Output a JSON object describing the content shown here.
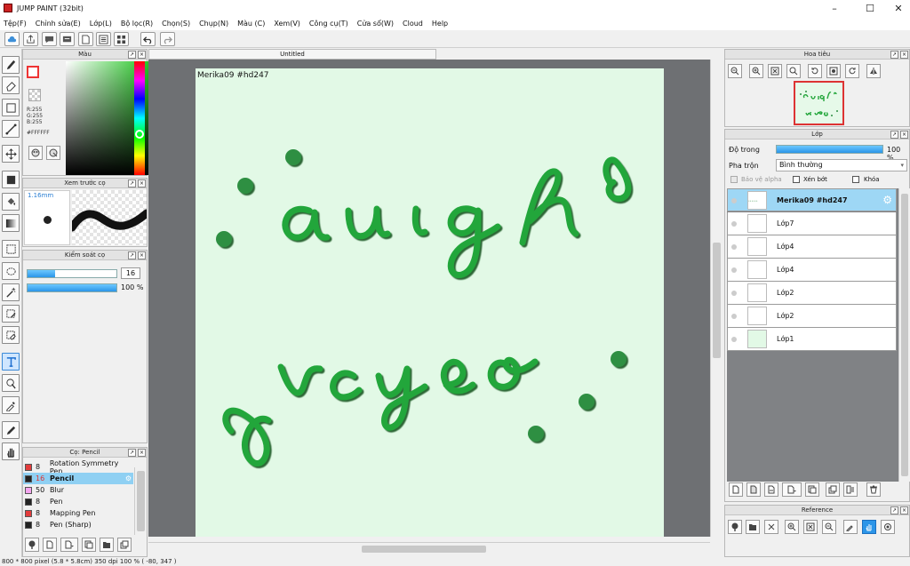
{
  "window": {
    "title": "JUMP PAINT (32bit)"
  },
  "menu": [
    "Tệp(F)",
    "Chỉnh sửa(E)",
    "Lớp(L)",
    "Bộ lọc(R)",
    "Chọn(S)",
    "Chụp(N)",
    "Màu (C)",
    "Xem(V)",
    "Công cụ(T)",
    "Cửa sổ(W)",
    "Cloud",
    "Help"
  ],
  "document": {
    "tab": "Untitled",
    "canvas_text": "Merika09  #hd247"
  },
  "color_panel": {
    "title": "Màu",
    "r": "R:255",
    "g": "G:255",
    "b": "B:255",
    "hex": "#FFFFFF"
  },
  "brush_preview": {
    "title": "Xem trước cọ",
    "size": "1.16mm"
  },
  "brush_control": {
    "title": "Kiểm soát cọ",
    "size": "16",
    "opacity": "100 %",
    "size_fraction": 0.31,
    "opacity_fraction": 1.0
  },
  "brush_panel": {
    "title": "Cọ: Pencil",
    "items": [
      {
        "size": "8",
        "name": "Rotation Symmetry Pen",
        "color": "#e23b3b"
      },
      {
        "size": "16",
        "name": "Pencil",
        "color": "#222222",
        "selected": true
      },
      {
        "size": "50",
        "name": "Blur",
        "color": "#f5a6f0"
      },
      {
        "size": "8",
        "name": "Pen",
        "color": "#222222"
      },
      {
        "size": "8",
        "name": "Mapping Pen",
        "color": "#e23b3b"
      },
      {
        "size": "8",
        "name": "Pen (Sharp)",
        "color": "#222222"
      }
    ]
  },
  "navigator": {
    "title": "Hoa tiêu"
  },
  "layer_panel": {
    "title": "Lớp",
    "opacity_label": "Độ trong",
    "opacity_value": "100 %",
    "opacity_fraction": 1.0,
    "blend_label": "Pha trộn",
    "blend_value": "Bình thường",
    "protect_alpha": "Bảo vệ alpha",
    "clipping": "Xén bớt",
    "lock": "Khóa",
    "layers": [
      {
        "name": "Merika09  #hd247",
        "selected": true
      },
      {
        "name": "Lớp7"
      },
      {
        "name": "Lớp4"
      },
      {
        "name": "Lớp4"
      },
      {
        "name": "Lớp2"
      },
      {
        "name": "Lớp2"
      },
      {
        "name": "Lớp1"
      }
    ]
  },
  "reference": {
    "title": "Reference"
  },
  "status": {
    "text": "800 * 800 pixel   (5.8 * 5.8cm)  350 dpi  100 %  ( -80, 347 )"
  },
  "colors": {
    "accent": "#2b95e8",
    "ink": "#1a8f2a",
    "canvas_bg": "#e2f9e6"
  }
}
